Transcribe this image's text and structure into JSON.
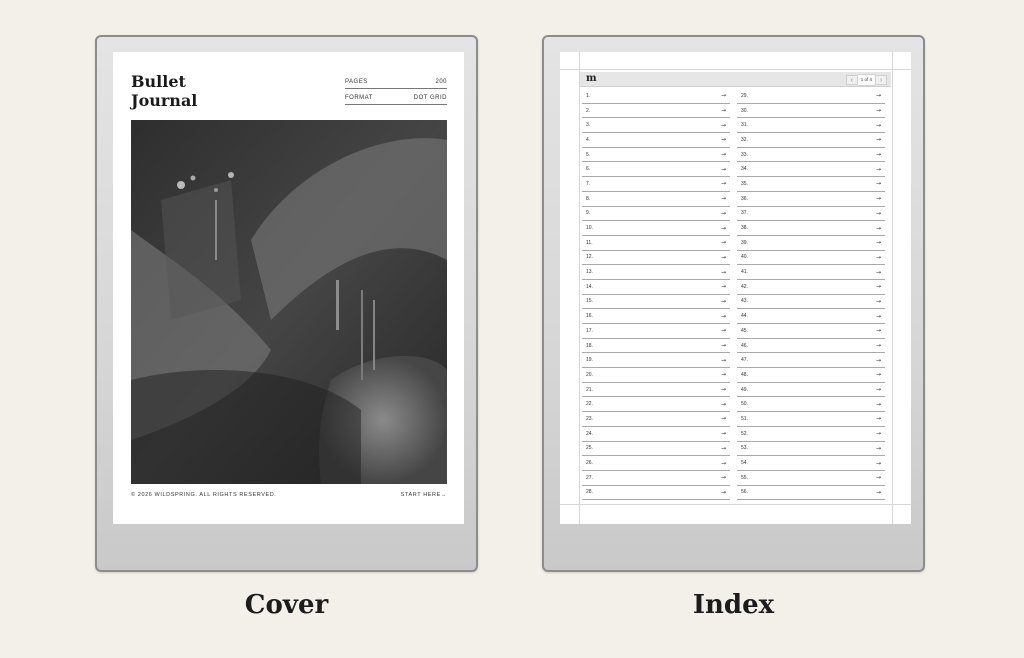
{
  "cover": {
    "title_line1": "Bullet",
    "title_line2": "Journal",
    "meta": [
      {
        "label": "PAGES",
        "value": "200"
      },
      {
        "label": "FORMAT",
        "value": "DOT GRID"
      }
    ],
    "copyright": "© 2026 WILDSPRING. ALL RIGHTS RESERVED.",
    "start_link": "START HERE→",
    "caption": "Cover"
  },
  "index": {
    "logo": "m",
    "pager": {
      "prev": "‹",
      "label": "1 of 4",
      "next": "›"
    },
    "left_entries": [
      "1.",
      "2.",
      "3.",
      "4.",
      "5.",
      "6.",
      "7.",
      "8.",
      "9.",
      "10.",
      "11.",
      "12.",
      "13.",
      "14.",
      "15.",
      "16.",
      "17.",
      "18.",
      "19.",
      "20.",
      "21.",
      "22.",
      "23.",
      "24.",
      "25.",
      "26.",
      "27.",
      "28."
    ],
    "right_entries": [
      "29.",
      "30.",
      "31.",
      "32.",
      "33.",
      "34.",
      "35.",
      "36.",
      "37.",
      "38.",
      "39.",
      "40.",
      "41.",
      "42.",
      "43.",
      "44.",
      "45.",
      "46.",
      "47.",
      "48.",
      "49.",
      "50.",
      "51.",
      "52.",
      "53.",
      "54.",
      "55.",
      "56."
    ],
    "arrow": "→",
    "caption": "Index"
  }
}
